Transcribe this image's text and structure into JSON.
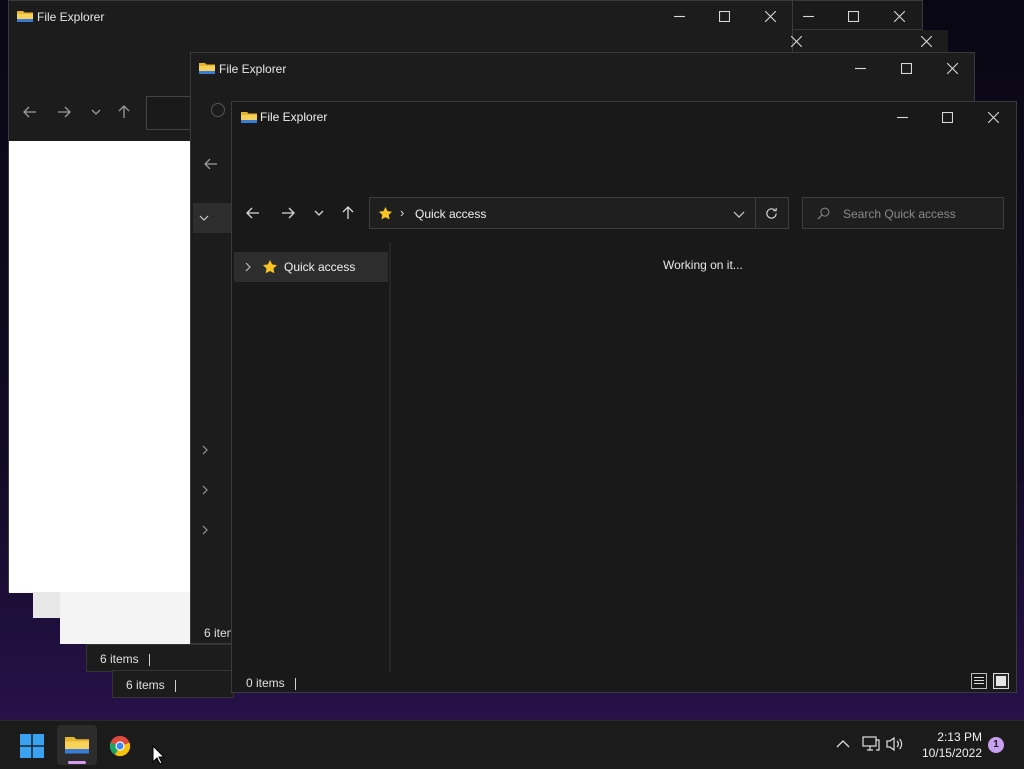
{
  "windows": {
    "back1": {
      "title": "File Explorer",
      "status_items": "6 items"
    },
    "back2": {
      "title": "File Explorer",
      "status_items": "6 items"
    },
    "back3": {
      "status_items": "6 items"
    },
    "back4": {
      "status_items": "6 item"
    },
    "front": {
      "title": "File Explorer",
      "address": {
        "location": "Quick access",
        "separator": "›"
      },
      "search": {
        "placeholder": "Search Quick access"
      },
      "nav_tree": [
        {
          "label": "Quick access",
          "icon": "star-icon",
          "selected": true
        }
      ],
      "content_message": "Working on it...",
      "status_items": "0 items"
    }
  },
  "taskbar": {
    "apps": [
      {
        "name": "start",
        "icon": "windows-logo-icon"
      },
      {
        "name": "file-explorer",
        "icon": "folder-icon",
        "active": true
      },
      {
        "name": "chrome",
        "icon": "chrome-icon"
      }
    ],
    "clock": {
      "time": "2:13 PM",
      "date": "10/15/2022"
    },
    "notification_count": "1"
  },
  "colors": {
    "accent_folder": "#f3c52f",
    "star": "#f7c325",
    "window_bg": "#1c1c1c",
    "notif_badge": "#c9a0f0",
    "active_indicator": "#d49cf0"
  }
}
